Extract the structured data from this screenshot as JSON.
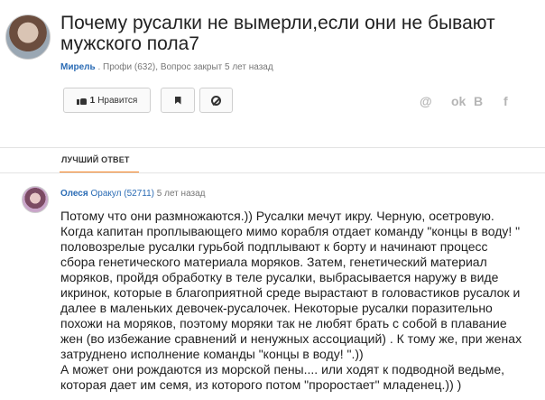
{
  "question": {
    "title": "Почему русалки не вымерли,если они не бывают мужского пола7",
    "author": "Мирель",
    "author_rank": "Профи (632)",
    "status": "Вопрос закрыт 5 лет назад"
  },
  "actions": {
    "like_count": "1",
    "like_label": "Нравится"
  },
  "share": {
    "icons": [
      "at-icon",
      "odnoklassniki-icon",
      "vk-icon",
      "facebook-icon"
    ],
    "at": "@",
    "ok": "ok",
    "vk": "B",
    "fb": "f"
  },
  "tabs": {
    "best_answer": "ЛУЧШИЙ ОТВЕТ"
  },
  "colors": {
    "accent": "#f58220",
    "link": "#2b6cb5"
  },
  "answer": {
    "author": "Олеся",
    "author_rank": "Оракул (52711)",
    "time": "5 лет назад",
    "text": "Потому что они размножаются.)) Русалки мечут икру. Черную, осетровую.\nКогда капитан проплывающего мимо корабля отдает команду \"концы в воду! \"\nполовозрелые русалки гурьбой подплывают к борту и начинают процесс\nсбора генетического материала моряков. Затем, генетический материал\nморяков, пройдя обработку в теле русалки, выбрасывается наружу в виде\nикринок, которые в благоприятной среде вырастают в головастиков русалок и\nдалее в маленьких девочек-русалочек. Некоторые русалки поразительно\nпохожи на моряков, поэтому моряки так не любят брать с собой в плавание\nжен (во избежание сравнений и ненужных ассоциаций) . К тому же, при женах\nзатруднено исполнение команды \"концы в воду! \".))\nА может они рождаются из морской пены.... или ходят к подводной ведьме,\nкоторая дает им семя, из которого потом \"проростает\" младенец.)) )"
  }
}
